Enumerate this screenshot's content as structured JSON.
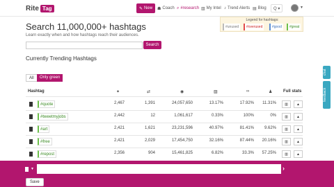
{
  "nav": {
    "logo_text": "Rite",
    "logo_tag": "Tag",
    "new_label": "New",
    "coach_label": "Coach",
    "research_label": "#research",
    "intel_label": "My Intel",
    "alerts_label": "Trend Alerts",
    "blog_label": "Blog",
    "search_label": "Q ▾"
  },
  "main": {
    "title": "Search 11,000,000+ hashtags",
    "subtitle": "Learn exactly when and how hashtags reach their audiences.",
    "search_placeholder": "",
    "search_button": "Search",
    "section_title": "Currently Trending Hashtags",
    "filter_all": "All",
    "filter_green": "Only green"
  },
  "legend": {
    "title": "Legend for hashtags:",
    "unused": "#unused",
    "overused": "#overused",
    "good": "#good",
    "great": "#great"
  },
  "table": {
    "header_hashtag": "Hashtag",
    "header_full_stats": "Full stats",
    "header_icons": [
      "twitter-icon",
      "retweet-icon",
      "eye-icon",
      "image-icon",
      "link-icon",
      "user-icon"
    ],
    "rows": [
      {
        "tag": "#quote",
        "c1": "2,467",
        "c2": "1,391",
        "c3": "24,057,650",
        "c4": "13.17%",
        "c5": "17.92%",
        "c6": "11.31%"
      },
      {
        "tag": "#tweetmyjobs",
        "c1": "2,442",
        "c2": "12",
        "c3": "1,061,617",
        "c4": "0.33%",
        "c5": "100%",
        "c6": "0%"
      },
      {
        "tag": "#art",
        "c1": "2,421",
        "c2": "1,621",
        "c3": "23,231,596",
        "c4": "40.97%",
        "c5": "81.41%",
        "c6": "9.62%"
      },
      {
        "tag": "#free",
        "c1": "2,421",
        "c2": "2,029",
        "c3": "17,454,750",
        "c4": "32.16%",
        "c5": "87.44%",
        "c6": "20.16%"
      },
      {
        "tag": "#repost",
        "c1": "2,356",
        "c2": "904",
        "c3": "15,461,825",
        "c4": "6.82%",
        "c5": "33.3%",
        "c6": "57.25%"
      }
    ]
  },
  "side": {
    "chat": "chat",
    "feedback": "feedback"
  },
  "composer": {
    "save": "Save"
  },
  "colors": {
    "brand": "#b2166e",
    "great": "#6cc04a",
    "good": "#5b8fd6",
    "overused": "#e24a4a",
    "unused": "#bbbbbb",
    "side_tab": "#3aa8c1"
  }
}
